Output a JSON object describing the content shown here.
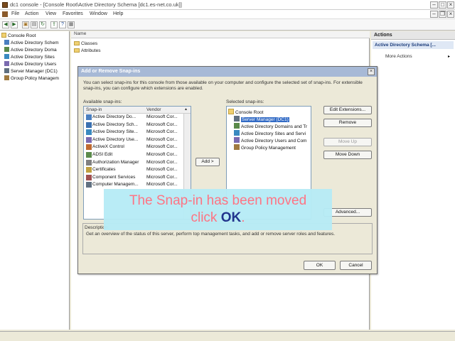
{
  "window": {
    "title": "dc1 console - [Console Root\\Active Directory Schema [dc1.es-net.co.uk]]"
  },
  "menu": {
    "items": [
      "File",
      "Action",
      "View",
      "Favorites",
      "Window",
      "Help"
    ]
  },
  "tree": {
    "items": [
      "Console Root",
      "Active Directory Schem",
      "Active Directory Doma",
      "Active Directory Sites",
      "Active Directory Users",
      "Server Manager (DC1)",
      "Group Policy Managem"
    ]
  },
  "center": {
    "header": "Name",
    "items": [
      "Classes",
      "Attributes"
    ]
  },
  "actions": {
    "header": "Actions",
    "selected": "Active Directory Schema [...",
    "more": "More Actions"
  },
  "dialog": {
    "title": "Add or Remove Snap-ins",
    "description": "You can select snap-ins for this console from those available on your computer and configure the selected set of snap-ins. For extensible snap-ins, you can configure which extensions are enabled.",
    "available_label": "Available snap-ins:",
    "selected_label": "Selected snap-ins:",
    "col_snapin": "Snap-in",
    "col_vendor": "Vendor",
    "available": [
      {
        "name": "Active Directory Do...",
        "vendor": "Microsoft Cor..."
      },
      {
        "name": "Active Directory Sch...",
        "vendor": "Microsoft Cor..."
      },
      {
        "name": "Active Directory Site...",
        "vendor": "Microsoft Cor..."
      },
      {
        "name": "Active Directory Use...",
        "vendor": "Microsoft Cor..."
      },
      {
        "name": "ActiveX Control",
        "vendor": "Microsoft Cor..."
      },
      {
        "name": "ADSI Edit",
        "vendor": "Microsoft Cor..."
      },
      {
        "name": "Authorization Manager",
        "vendor": "Microsoft Cor..."
      },
      {
        "name": "Certificates",
        "vendor": "Microsoft Cor..."
      },
      {
        "name": "Component Services",
        "vendor": "Microsoft Cor..."
      },
      {
        "name": "Computer Managem...",
        "vendor": "Microsoft Cor..."
      }
    ],
    "selected_root": "Console Root",
    "selected": [
      "Server Manager (DC1)",
      "Active Directory Domains and Tr",
      "Active Directory Sites and Servi",
      "Active Directory Users and Com",
      "Group Policy Management"
    ],
    "add_button": "Add >",
    "edit_extensions": "Edit Extensions...",
    "remove": "Remove",
    "move_up": "Move Up",
    "move_down": "Move Down",
    "advanced": "Advanced...",
    "description_label": "Description:",
    "item_description": "Get an overview of the status of this server, perform top management tasks, and add or remove server roles and features.",
    "ok": "OK",
    "cancel": "Cancel"
  },
  "overlay": {
    "line1": "The Snap-in has been moved",
    "line2_prefix": "click ",
    "line2_bold": "OK",
    "line2_suffix": "."
  },
  "colors": {
    "overlay_bg": "#b7ecf6",
    "overlay_text": "#ff6f7f",
    "overlay_emphasis": "#1a2d8a",
    "selection": "#316ac5"
  }
}
